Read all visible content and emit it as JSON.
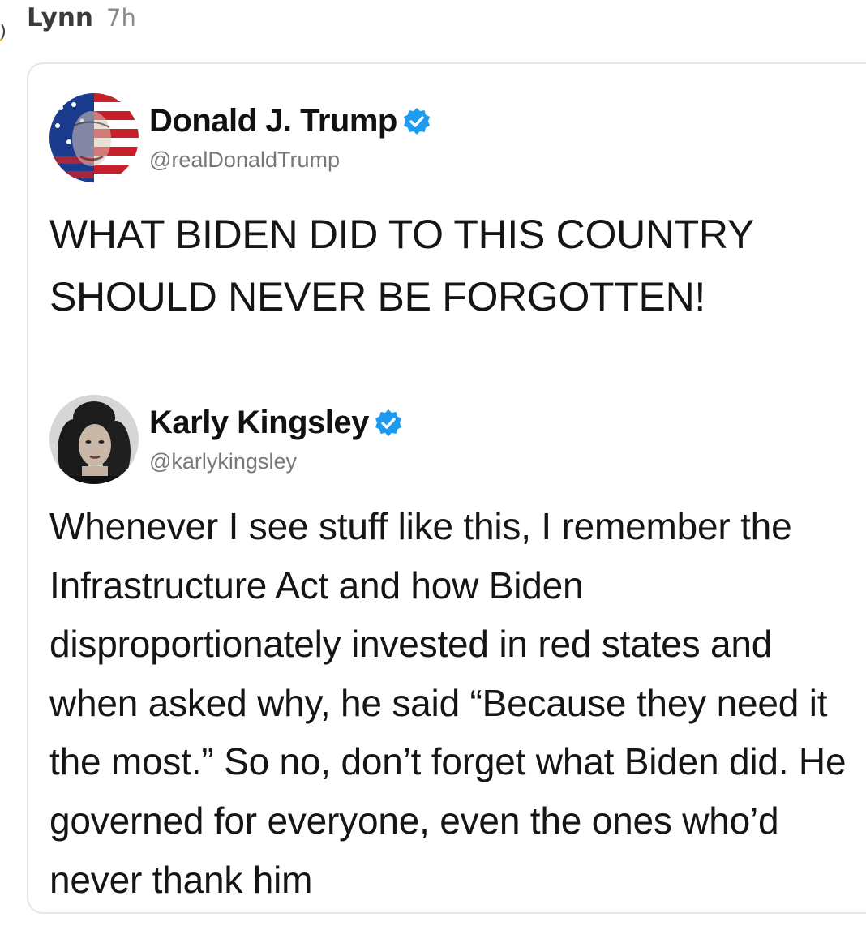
{
  "comment": {
    "username": "Lynn",
    "time": "7h"
  },
  "quoted_tweet": {
    "name": "Donald J. Trump",
    "handle": "@realDonaldTrump",
    "verified": true,
    "avatar_icon": "flag-face-avatar",
    "text": "WHAT BIDEN DID TO THIS COUNTRY SHOULD NEVER BE FORGOTTEN!"
  },
  "reply_tweet": {
    "name": "Karly Kingsley",
    "handle": "@karlykingsley",
    "verified": true,
    "avatar_icon": "woman-portrait-avatar",
    "text": "Whenever I see stuff like this, I remember the Infrastructure Act and how Biden disproportionately invested in red states and when asked why, he said “Because they need it the most.” So no, don’t forget what Biden did. He governed for everyone, even the ones who’d never thank him"
  },
  "colors": {
    "verified_blue": "#1d9bf0",
    "handle_gray": "#787878",
    "card_border": "#e6e6e6"
  }
}
